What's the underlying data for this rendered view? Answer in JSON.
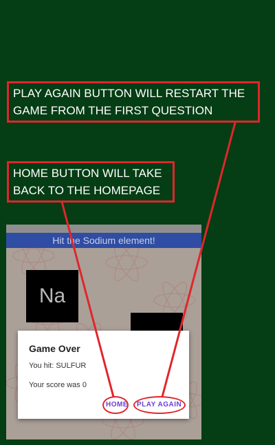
{
  "annotations": {
    "play_again_note": "PLAY AGAIN BUTTON WILL RESTART THE GAME FROM THE FIRST QUESTION",
    "home_note": "HOME BUTTON WILL TAKE BACK TO THE HOMEPAGE",
    "color": "#e0262b"
  },
  "game": {
    "banner": "Hit the Sodium element!",
    "tile_label": "Na"
  },
  "dialog": {
    "title": "Game Over",
    "hit_text": "You hit: SULFUR",
    "score_text": "Your score was 0",
    "home_label": "HOME",
    "play_again_label": "PLAY AGAIN",
    "accent": "#6a3fd6"
  },
  "colors": {
    "background": "#053d14",
    "banner": "#2f4da3"
  }
}
